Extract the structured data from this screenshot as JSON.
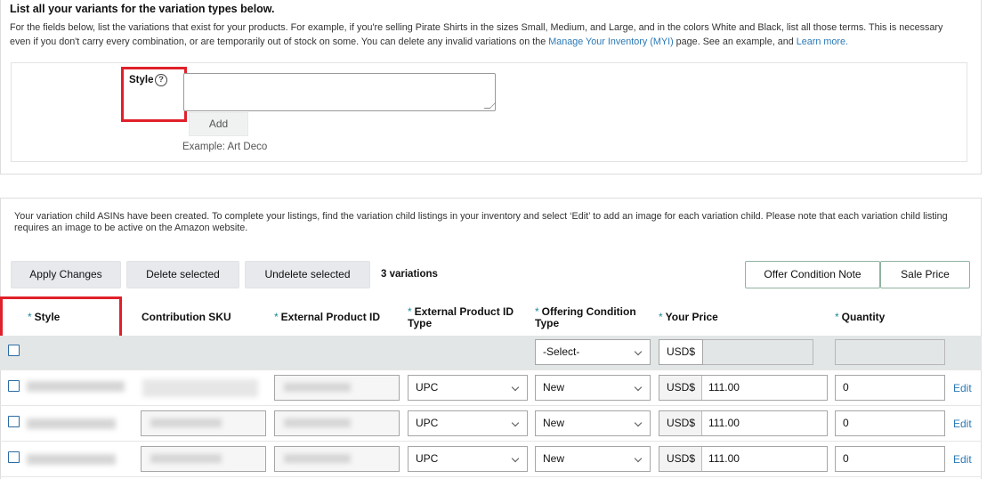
{
  "variants_section": {
    "heading": "List all your variants for the variation types below.",
    "description_lead": "For the fields below, list the variations that exist for your products. For example, if you're selling Pirate Shirts in the sizes Small, Medium, and Large, and in the colors White and Black, list all those terms. This is necessary even if you don't carry every combination, or are temporarily out of stock on some. You can delete any invalid variations on the ",
    "myi_link": "Manage Your Inventory (MYI)",
    "description_mid": " page. See an example, and ",
    "learn_more_link": "Learn more.",
    "style_label": "Style",
    "help_glyph": "?",
    "add_button": "Add",
    "example": "Example: Art Deco"
  },
  "notice": "Your variation child ASINs have been created. To complete your listings, find the variation child listings in your inventory and select ‘Edit’ to add an image for each variation child. Please note that each variation child listing requires an image to be active on the Amazon website.",
  "toolbar": {
    "apply": "Apply Changes",
    "delete": "Delete selected",
    "undelete": "Undelete selected",
    "count": "3 variations",
    "offer_note": "Offer Condition Note",
    "sale_price": "Sale Price"
  },
  "table": {
    "required_marker": "*",
    "columns": {
      "style": "Style",
      "sku": "Contribution SKU",
      "ext_id": "External Product ID",
      "ext_type": "External Product ID Type",
      "condition": "Offering Condition Type",
      "price": "Your Price",
      "quantity": "Quantity"
    },
    "bulk_row": {
      "condition": "-Select-",
      "currency": "USD$"
    },
    "rows": [
      {
        "id_type": "UPC",
        "condition": "New",
        "currency": "USD$",
        "price": "111.00",
        "quantity": "0",
        "edit": "Edit"
      },
      {
        "id_type": "UPC",
        "condition": "New",
        "currency": "USD$",
        "price": "111.00",
        "quantity": "0",
        "edit": "Edit"
      },
      {
        "id_type": "UPC",
        "condition": "New",
        "currency": "USD$",
        "price": "111.00",
        "quantity": "0",
        "edit": "Edit"
      }
    ]
  },
  "colors": {
    "link": "#2a79b6",
    "highlight": "#e0202a",
    "required": "#1f8a99"
  }
}
